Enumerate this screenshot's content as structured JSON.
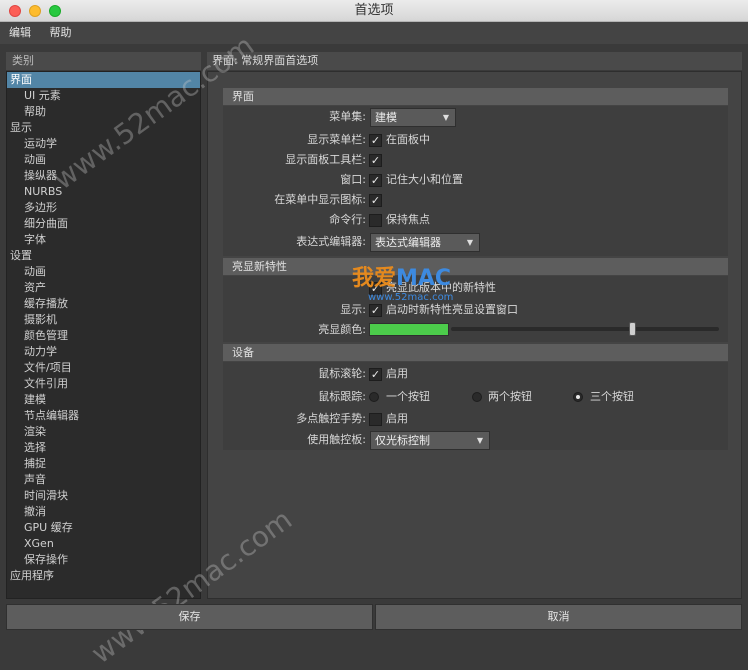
{
  "window": {
    "title": "首选项"
  },
  "menubar": {
    "items": [
      "编辑",
      "帮助"
    ]
  },
  "sidebar": {
    "header": "类别",
    "items": [
      {
        "label": "界面",
        "level": 0,
        "selected": true
      },
      {
        "label": "UI 元素",
        "level": 1
      },
      {
        "label": "帮助",
        "level": 1
      },
      {
        "label": "显示",
        "level": 0
      },
      {
        "label": "运动学",
        "level": 1
      },
      {
        "label": "动画",
        "level": 1
      },
      {
        "label": "操纵器",
        "level": 1
      },
      {
        "label": "NURBS",
        "level": 1
      },
      {
        "label": "多边形",
        "level": 1
      },
      {
        "label": "细分曲面",
        "level": 1
      },
      {
        "label": "字体",
        "level": 1
      },
      {
        "label": "设置",
        "level": 0
      },
      {
        "label": "动画",
        "level": 1
      },
      {
        "label": "资产",
        "level": 1
      },
      {
        "label": "缓存播放",
        "level": 1
      },
      {
        "label": "摄影机",
        "level": 1
      },
      {
        "label": "颜色管理",
        "level": 1
      },
      {
        "label": "动力学",
        "level": 1
      },
      {
        "label": "文件/项目",
        "level": 1
      },
      {
        "label": "文件引用",
        "level": 1
      },
      {
        "label": "建模",
        "level": 1
      },
      {
        "label": "节点编辑器",
        "level": 1
      },
      {
        "label": "渲染",
        "level": 1
      },
      {
        "label": "选择",
        "level": 1
      },
      {
        "label": "捕捉",
        "level": 1
      },
      {
        "label": "声音",
        "level": 1
      },
      {
        "label": "时间滑块",
        "level": 1
      },
      {
        "label": "撤消",
        "level": 1
      },
      {
        "label": "GPU 缓存",
        "level": 1
      },
      {
        "label": "XGen",
        "level": 1
      },
      {
        "label": "保存操作",
        "level": 1
      },
      {
        "label": "应用程序",
        "level": 0
      }
    ]
  },
  "main": {
    "header": "界面: 常规界面首选项",
    "interface_section": {
      "title": "界面",
      "menu_set_label": "菜单集:",
      "menu_set_value": "建模",
      "show_menubar_label": "显示菜单栏:",
      "show_menubar_option": "在面板中",
      "show_panel_toolbar_label": "显示面板工具栏:",
      "window_label": "窗口:",
      "window_option": "记住大小和位置",
      "show_icons_in_menu_label": "在菜单中显示图标:",
      "command_line_label": "命令行:",
      "command_line_option": "保持焦点",
      "expression_editor_label": "表达式编辑器:",
      "expression_editor_value": "表达式编辑器"
    },
    "highlight_section": {
      "title": "亮显新特性",
      "option1": "亮显此版本中的新特性",
      "display_label": "显示:",
      "display_option": "启动时新特性亮显设置窗口",
      "color_label": "亮显颜色:",
      "color": "#4ccc4b",
      "slider_fraction": 0.68
    },
    "device_section": {
      "title": "设备",
      "mouse_scroll_label": "鼠标滚轮:",
      "mouse_scroll_option": "启用",
      "mouse_tracking_label": "鼠标跟踪:",
      "radio_one": "一个按钮",
      "radio_two": "两个按钮",
      "radio_three": "三个按钮",
      "multitouch_label": "多点触控手势:",
      "multitouch_option": "启用",
      "touchpad_label": "使用触控板:",
      "touchpad_value": "仅光标控制"
    }
  },
  "footer": {
    "save": "保存",
    "cancel": "取消"
  },
  "watermark": {
    "text": "www.52mac.com",
    "logo_cn": "我爱",
    "logo_mac": "MAC",
    "logo_url": "www.52mac.com"
  }
}
